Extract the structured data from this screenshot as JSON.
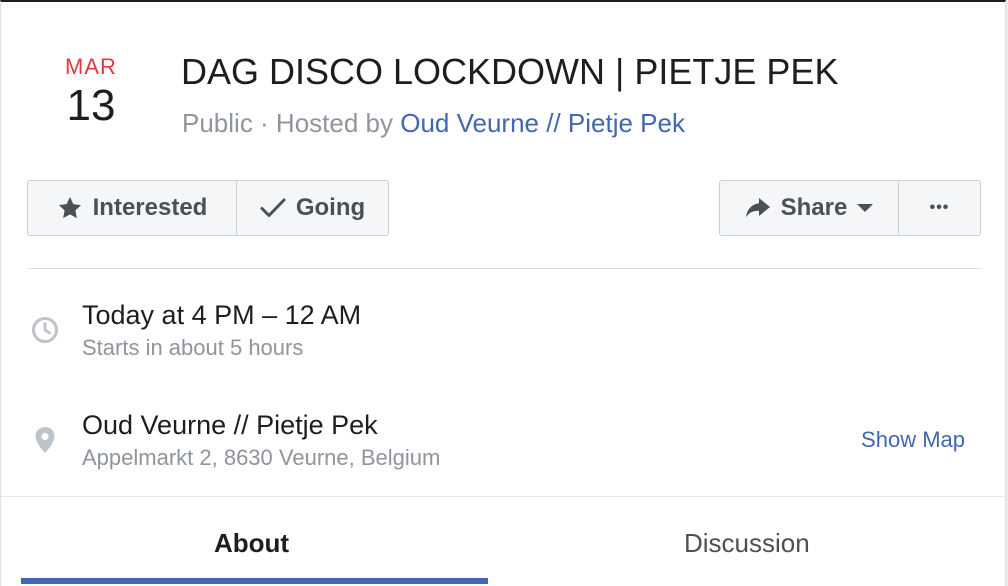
{
  "event": {
    "month": "MAR",
    "day": "13",
    "title": "DAG DISCO LOCKDOWN | PIETJE PEK",
    "privacy": "Public",
    "hosted_by_prefix": " · Hosted by ",
    "host": "Oud Veurne // Pietje Pek"
  },
  "actions": {
    "interested_label": "Interested",
    "going_label": "Going",
    "share_label": "Share",
    "more_label": "•••"
  },
  "details": {
    "time": "Today at 4 PM – 12 AM",
    "time_sub": "Starts in about 5 hours",
    "venue": "Oud Veurne // Pietje Pek",
    "address": "Appelmarkt 2, 8630 Veurne, Belgium",
    "show_map_label": "Show Map"
  },
  "tabs": [
    {
      "label": "About",
      "active": true
    },
    {
      "label": "Discussion",
      "active": false
    }
  ],
  "icons": {
    "interested": "star-icon",
    "going": "checkmark-icon",
    "share": "share-arrow-icon",
    "caret": "caret-down-icon",
    "time": "clock-icon",
    "location": "location-pin-icon"
  },
  "colors": {
    "month": "#e0393e",
    "link": "#4267b2",
    "muted": "#90949c",
    "text": "#1c1e21"
  }
}
